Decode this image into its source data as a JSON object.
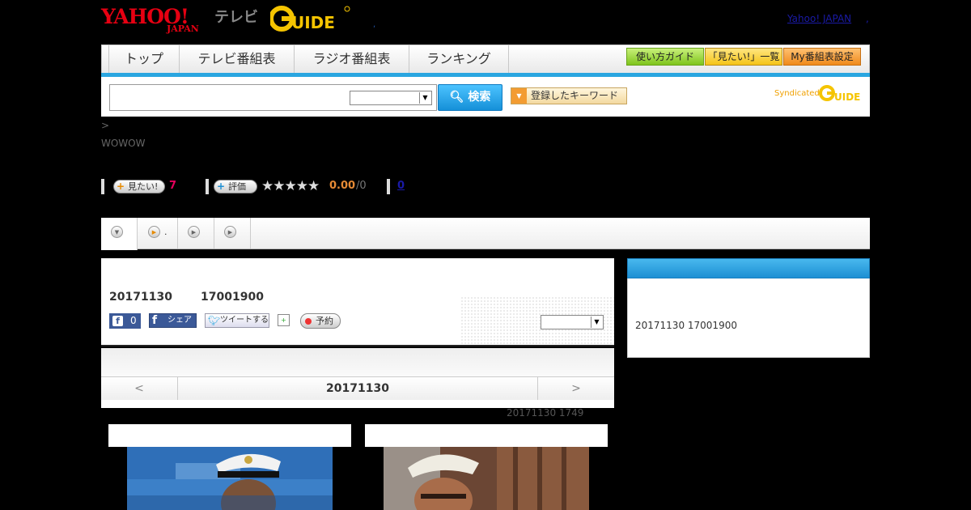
{
  "header": {
    "yahoo_logo": "YAHOO!",
    "yahoo_sub": "JAPAN",
    "tv_label": "テレビ",
    "gguide_logo": "G GUIDE",
    "dot": ",",
    "yahoo_japan_link": "Yahoo! JAPAN",
    "link_dot": ","
  },
  "nav": {
    "tabs": [
      "トップ",
      "テレビ番組表",
      "ラジオ番組表",
      "ランキング"
    ],
    "buttons": [
      "使い方ガイド",
      "「見たい!」一覧",
      "My番組表設定"
    ],
    "accent": "#2aa6e0"
  },
  "search": {
    "input_value": "",
    "search_button": "検索",
    "keyword_button": "登録したキーワード",
    "syndicated": "Syndicated"
  },
  "breadcrumb": ">",
  "channel": "WOWOW",
  "rating": {
    "want_label": "見たい!",
    "want_count": "7",
    "eval_label": "評価",
    "stars": "★★★★★",
    "score": "0.00",
    "score_total": "/0",
    "review_count": "0"
  },
  "tabs_row": {
    "tab2_label": "."
  },
  "program": {
    "date": "20171130",
    "time": "17001900",
    "fb_like_count": "0",
    "fb_share": "シェア",
    "tweet": "ツイートする",
    "record": "予約"
  },
  "datenav": {
    "prev": "<",
    "date": "20171130",
    "next": ">"
  },
  "updated": "20171130  1749",
  "sidebar": {
    "text": "20171130  17001900"
  }
}
